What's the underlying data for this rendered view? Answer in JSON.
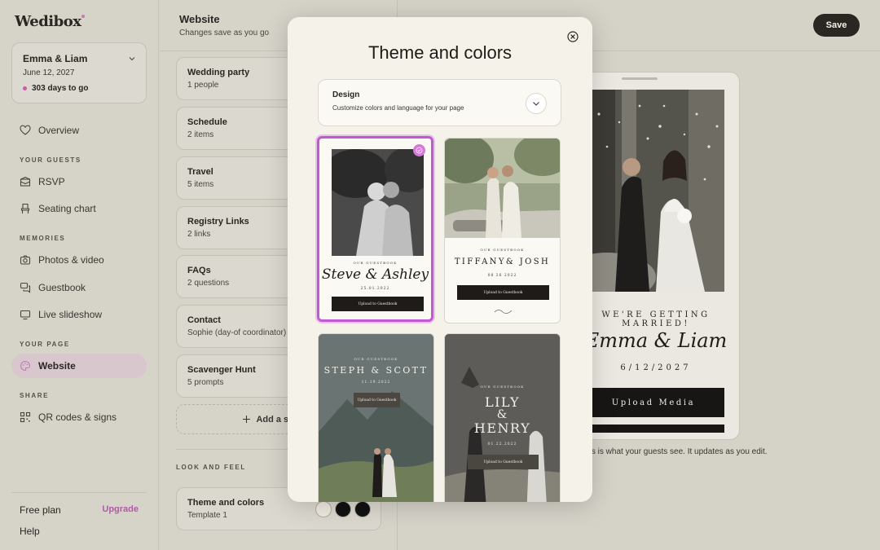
{
  "app": {
    "brand": "Wedibox"
  },
  "event": {
    "name": "Emma & Liam",
    "date": "June 12, 2027",
    "countdown": "303 days to go"
  },
  "nav": {
    "overview": "Overview",
    "section_guests": "YOUR GUESTS",
    "rsvp": "RSVP",
    "seating": "Seating chart",
    "section_memories": "MEMORIES",
    "photos": "Photos & video",
    "guestbook": "Guestbook",
    "slideshow": "Live slideshow",
    "section_page": "YOUR PAGE",
    "website": "Website",
    "section_share": "SHARE",
    "qr": "QR codes & signs"
  },
  "footer": {
    "plan": "Free plan",
    "upgrade": "Upgrade",
    "help": "Help"
  },
  "page": {
    "title": "Website",
    "subtitle": "Changes save as you go",
    "save_label": "Save"
  },
  "sections": [
    {
      "title": "Wedding party",
      "sub": "1 people"
    },
    {
      "title": "Schedule",
      "sub": "2 items"
    },
    {
      "title": "Travel",
      "sub": "5 items"
    },
    {
      "title": "Registry Links",
      "sub": "2 links"
    },
    {
      "title": "FAQs",
      "sub": "2 questions"
    },
    {
      "title": "Contact",
      "sub": "Sophie (day-of coordinator)"
    },
    {
      "title": "Scavenger Hunt",
      "sub": "5 prompts"
    }
  ],
  "add_section": "Add a section",
  "look_and_feel": {
    "label": "LOOK AND FEEL",
    "theme_title": "Theme and colors",
    "theme_sub": "Template 1",
    "swatch_colors": [
      "#eeeae2",
      "#111111",
      "#111111"
    ]
  },
  "preview": {
    "kicker": "WE'RE GETTING MARRIED!",
    "names": "Emma & Liam",
    "date": "6/12/2027",
    "upload": "Upload Media",
    "note": "This is what your guests see. It updates as you edit."
  },
  "modal": {
    "title": "Theme and colors",
    "design_title": "Design",
    "design_sub": "Customize colors and language for your page",
    "templates": [
      {
        "kicker": "OUR GUESTBOOK",
        "names": "Steve & Ashley",
        "date": "25.01.2022",
        "button": "Upload to Guestbook",
        "selected": true
      },
      {
        "kicker": "OUR GUESTBOOK",
        "names": "TIFFANY& JOSH",
        "date": "08 26 2022",
        "button": "Upload to Guestbook"
      },
      {
        "kicker": "OUR GUESTBOOK",
        "names": "STEPH & SCOTT",
        "date": "11.19.2022",
        "button": "Upload to Guestbook"
      },
      {
        "kicker": "OUR GUESTBOOK",
        "names_top": "LILY",
        "names_mid": "&",
        "names_bot": "HENRY",
        "date": "01.22.2022",
        "button": "Upload to Guestbook"
      }
    ]
  },
  "colors": {
    "accent": "#c05ad0",
    "brand_pink": "#d05aa8",
    "dark": "#2a2622"
  }
}
